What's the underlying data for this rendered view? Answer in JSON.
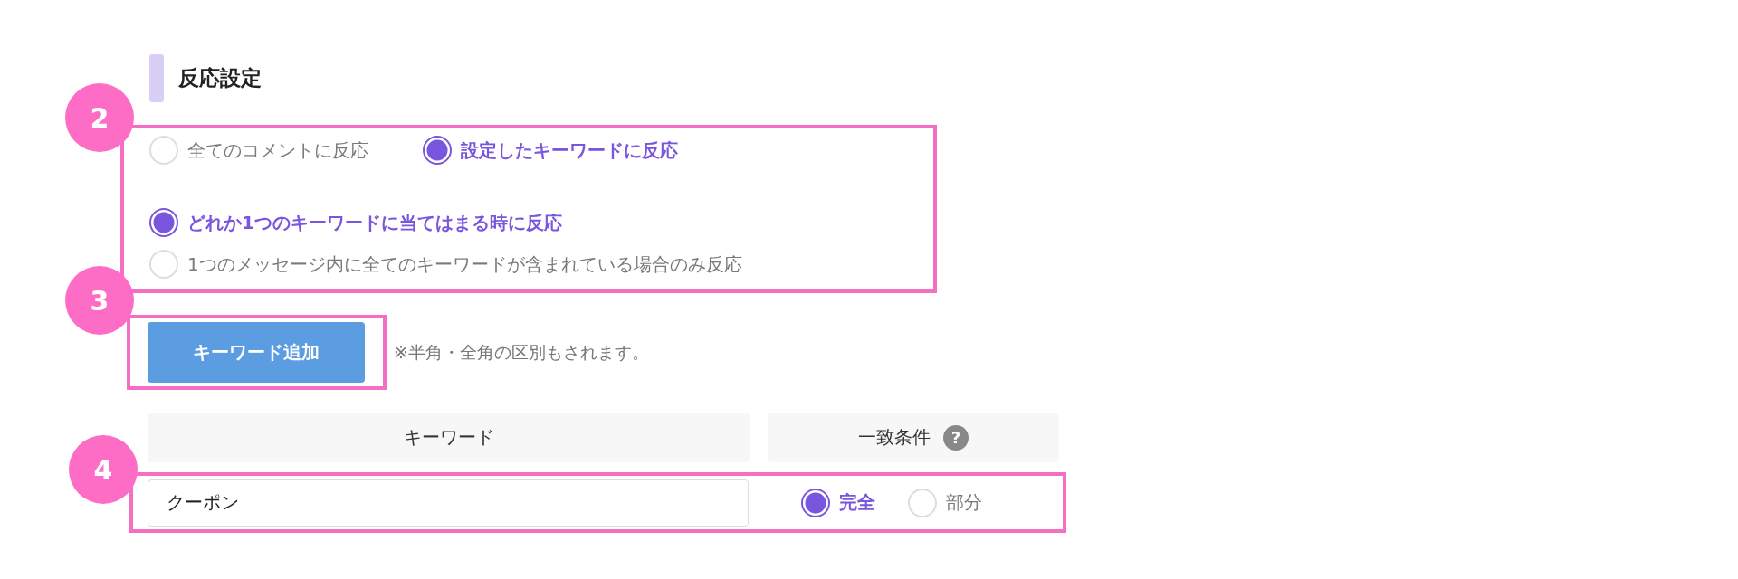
{
  "heading": "反応設定",
  "reaction": {
    "badge": "2",
    "groups": [
      {
        "options": [
          {
            "label": "全てのコメントに反応",
            "selected": false
          },
          {
            "label": "設定したキーワードに反応",
            "selected": true
          }
        ]
      },
      {
        "options": [
          {
            "label": "どれか1つのキーワードに当てはまる時に反応",
            "selected": true
          },
          {
            "label": "1つのメッセージ内に全てのキーワードが含まれている場合のみ反応",
            "selected": false
          }
        ]
      }
    ]
  },
  "add": {
    "badge": "3",
    "button": "キーワード追加",
    "note": "※半角・全角の区別もされます。"
  },
  "table": {
    "badge": "4",
    "columns": [
      {
        "label": "キーワード"
      },
      {
        "label": "一致条件",
        "help": "?"
      }
    ],
    "rows": [
      {
        "keyword": "クーポン",
        "conditions": [
          {
            "label": "完全",
            "selected": true
          },
          {
            "label": "部分",
            "selected": false
          }
        ]
      }
    ]
  }
}
